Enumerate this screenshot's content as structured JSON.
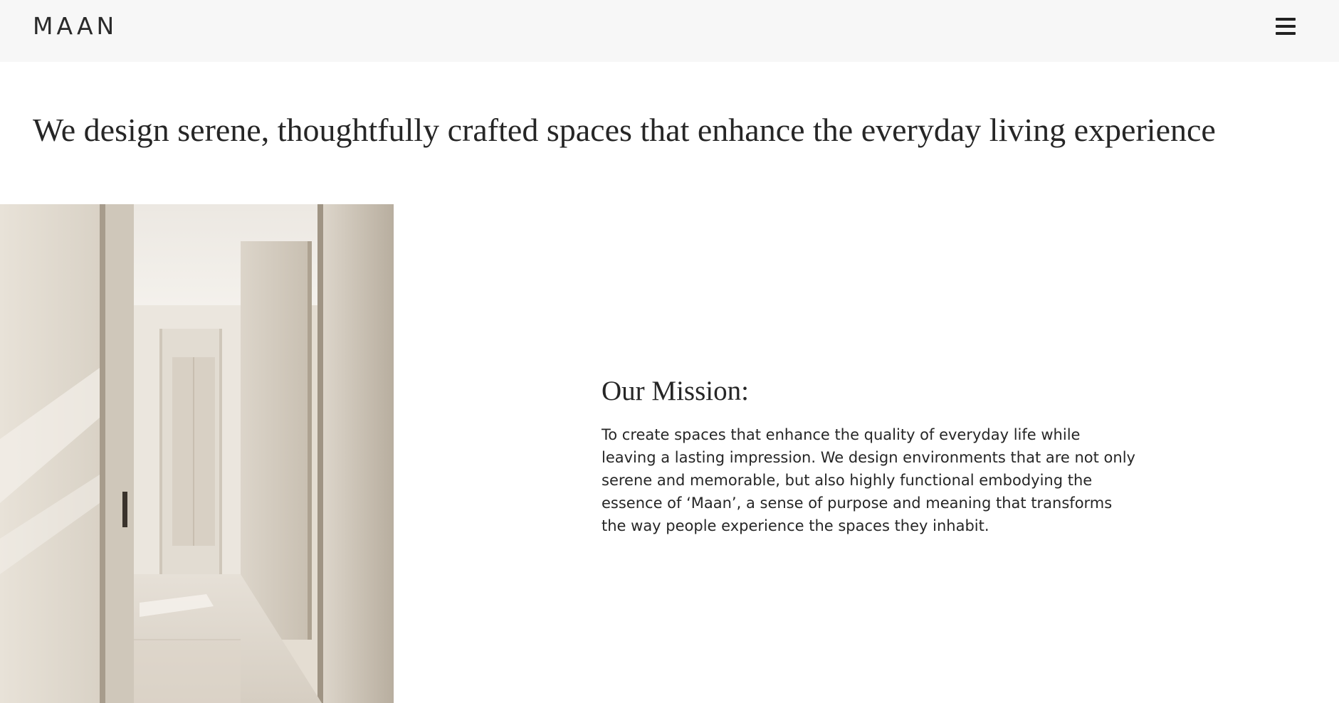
{
  "header": {
    "logo_text": "MAAN",
    "menu_icon": "hamburger-menu-icon"
  },
  "hero": {
    "headline": "We design serene, thoughtfully crafted spaces that enhance the everyday living experience"
  },
  "mission": {
    "title": "Our Mission:",
    "body": "To create spaces that enhance the quality of everyday life while leaving a lasting impression. We design environments that are not only serene and memorable, but also highly functional embodying the essence of ‘Maan’, a sense of purpose and meaning that transforms the way people experience the spaces they inhabit."
  },
  "image": {
    "subject": "interior-corridor-photo"
  }
}
